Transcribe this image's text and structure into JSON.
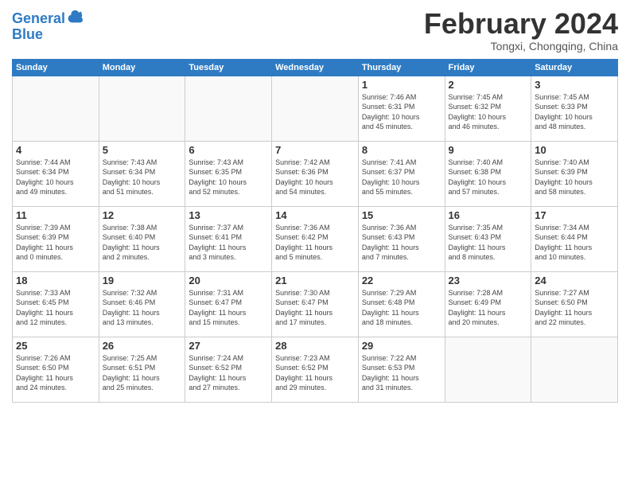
{
  "header": {
    "logo_line1": "General",
    "logo_line2": "Blue",
    "month": "February 2024",
    "location": "Tongxi, Chongqing, China"
  },
  "days_of_week": [
    "Sunday",
    "Monday",
    "Tuesday",
    "Wednesday",
    "Thursday",
    "Friday",
    "Saturday"
  ],
  "weeks": [
    [
      {
        "day": "",
        "info": ""
      },
      {
        "day": "",
        "info": ""
      },
      {
        "day": "",
        "info": ""
      },
      {
        "day": "",
        "info": ""
      },
      {
        "day": "1",
        "info": "Sunrise: 7:46 AM\nSunset: 6:31 PM\nDaylight: 10 hours\nand 45 minutes."
      },
      {
        "day": "2",
        "info": "Sunrise: 7:45 AM\nSunset: 6:32 PM\nDaylight: 10 hours\nand 46 minutes."
      },
      {
        "day": "3",
        "info": "Sunrise: 7:45 AM\nSunset: 6:33 PM\nDaylight: 10 hours\nand 48 minutes."
      }
    ],
    [
      {
        "day": "4",
        "info": "Sunrise: 7:44 AM\nSunset: 6:34 PM\nDaylight: 10 hours\nand 49 minutes."
      },
      {
        "day": "5",
        "info": "Sunrise: 7:43 AM\nSunset: 6:34 PM\nDaylight: 10 hours\nand 51 minutes."
      },
      {
        "day": "6",
        "info": "Sunrise: 7:43 AM\nSunset: 6:35 PM\nDaylight: 10 hours\nand 52 minutes."
      },
      {
        "day": "7",
        "info": "Sunrise: 7:42 AM\nSunset: 6:36 PM\nDaylight: 10 hours\nand 54 minutes."
      },
      {
        "day": "8",
        "info": "Sunrise: 7:41 AM\nSunset: 6:37 PM\nDaylight: 10 hours\nand 55 minutes."
      },
      {
        "day": "9",
        "info": "Sunrise: 7:40 AM\nSunset: 6:38 PM\nDaylight: 10 hours\nand 57 minutes."
      },
      {
        "day": "10",
        "info": "Sunrise: 7:40 AM\nSunset: 6:39 PM\nDaylight: 10 hours\nand 58 minutes."
      }
    ],
    [
      {
        "day": "11",
        "info": "Sunrise: 7:39 AM\nSunset: 6:39 PM\nDaylight: 11 hours\nand 0 minutes."
      },
      {
        "day": "12",
        "info": "Sunrise: 7:38 AM\nSunset: 6:40 PM\nDaylight: 11 hours\nand 2 minutes."
      },
      {
        "day": "13",
        "info": "Sunrise: 7:37 AM\nSunset: 6:41 PM\nDaylight: 11 hours\nand 3 minutes."
      },
      {
        "day": "14",
        "info": "Sunrise: 7:36 AM\nSunset: 6:42 PM\nDaylight: 11 hours\nand 5 minutes."
      },
      {
        "day": "15",
        "info": "Sunrise: 7:36 AM\nSunset: 6:43 PM\nDaylight: 11 hours\nand 7 minutes."
      },
      {
        "day": "16",
        "info": "Sunrise: 7:35 AM\nSunset: 6:43 PM\nDaylight: 11 hours\nand 8 minutes."
      },
      {
        "day": "17",
        "info": "Sunrise: 7:34 AM\nSunset: 6:44 PM\nDaylight: 11 hours\nand 10 minutes."
      }
    ],
    [
      {
        "day": "18",
        "info": "Sunrise: 7:33 AM\nSunset: 6:45 PM\nDaylight: 11 hours\nand 12 minutes."
      },
      {
        "day": "19",
        "info": "Sunrise: 7:32 AM\nSunset: 6:46 PM\nDaylight: 11 hours\nand 13 minutes."
      },
      {
        "day": "20",
        "info": "Sunrise: 7:31 AM\nSunset: 6:47 PM\nDaylight: 11 hours\nand 15 minutes."
      },
      {
        "day": "21",
        "info": "Sunrise: 7:30 AM\nSunset: 6:47 PM\nDaylight: 11 hours\nand 17 minutes."
      },
      {
        "day": "22",
        "info": "Sunrise: 7:29 AM\nSunset: 6:48 PM\nDaylight: 11 hours\nand 18 minutes."
      },
      {
        "day": "23",
        "info": "Sunrise: 7:28 AM\nSunset: 6:49 PM\nDaylight: 11 hours\nand 20 minutes."
      },
      {
        "day": "24",
        "info": "Sunrise: 7:27 AM\nSunset: 6:50 PM\nDaylight: 11 hours\nand 22 minutes."
      }
    ],
    [
      {
        "day": "25",
        "info": "Sunrise: 7:26 AM\nSunset: 6:50 PM\nDaylight: 11 hours\nand 24 minutes."
      },
      {
        "day": "26",
        "info": "Sunrise: 7:25 AM\nSunset: 6:51 PM\nDaylight: 11 hours\nand 25 minutes."
      },
      {
        "day": "27",
        "info": "Sunrise: 7:24 AM\nSunset: 6:52 PM\nDaylight: 11 hours\nand 27 minutes."
      },
      {
        "day": "28",
        "info": "Sunrise: 7:23 AM\nSunset: 6:52 PM\nDaylight: 11 hours\nand 29 minutes."
      },
      {
        "day": "29",
        "info": "Sunrise: 7:22 AM\nSunset: 6:53 PM\nDaylight: 11 hours\nand 31 minutes."
      },
      {
        "day": "",
        "info": ""
      },
      {
        "day": "",
        "info": ""
      }
    ]
  ]
}
